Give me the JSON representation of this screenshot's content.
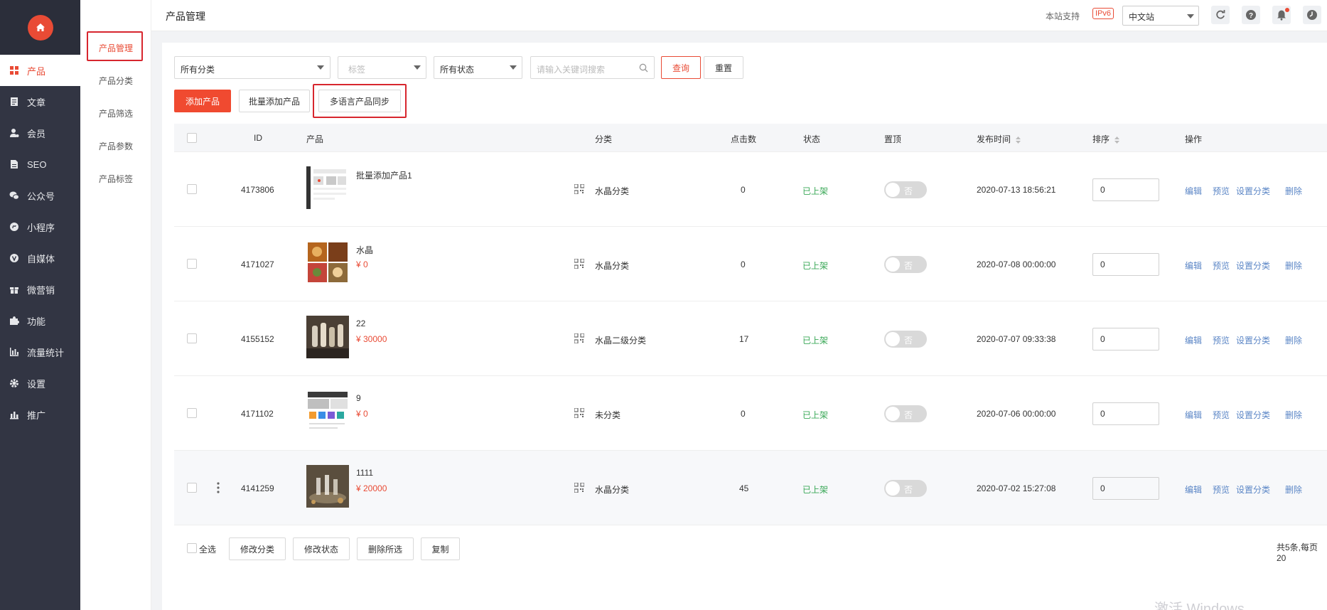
{
  "nav": {
    "items": [
      {
        "label": "产品",
        "icon": "grid-icon"
      },
      {
        "label": "文章",
        "icon": "document-icon"
      },
      {
        "label": "会员",
        "icon": "user-gear-icon"
      },
      {
        "label": "SEO",
        "icon": "file-icon"
      },
      {
        "label": "公众号",
        "icon": "wechat-icon"
      },
      {
        "label": "小程序",
        "icon": "mini-program-icon"
      },
      {
        "label": "自媒体",
        "icon": "v-icon"
      },
      {
        "label": "微营销",
        "icon": "gift-icon"
      },
      {
        "label": "功能",
        "icon": "puzzle-icon"
      },
      {
        "label": "流量统计",
        "icon": "bar-chart-icon"
      },
      {
        "label": "设置",
        "icon": "gear-icon"
      },
      {
        "label": "推广",
        "icon": "stats-icon"
      }
    ]
  },
  "subnav": {
    "items": [
      "产品管理",
      "产品分类",
      "产品筛选",
      "产品参数",
      "产品标签"
    ]
  },
  "header": {
    "title": "产品管理",
    "support_label": "本站支持",
    "ipv6_badge": "IPv6",
    "lang_selected": "中文站"
  },
  "filters": {
    "category": "所有分类",
    "tag_placeholder": "标签",
    "status": "所有状态",
    "search_placeholder": "请输入关键词搜索",
    "query_button": "查询",
    "reset_button": "重置"
  },
  "actions": {
    "add_product": "添加产品",
    "batch_add": "批量添加产品",
    "multi_lang_sync": "多语言产品同步"
  },
  "table": {
    "headers": {
      "id": "ID",
      "product": "产品",
      "category": "分类",
      "clicks": "点击数",
      "status": "状态",
      "pin": "置顶",
      "publish_time": "发布时间",
      "sort": "排序",
      "ops": "操作"
    },
    "toggle_label": "否",
    "op_labels": {
      "edit": "编辑",
      "preview": "预览",
      "set_category": "设置分类",
      "delete": "删除"
    },
    "rows": [
      {
        "id": "4173806",
        "name": "批量添加产品1",
        "price": "",
        "category": "水晶分类",
        "clicks": "0",
        "status": "已上架",
        "time": "2020-07-13 18:56:21",
        "sort": "0"
      },
      {
        "id": "4171027",
        "name": "水晶",
        "price": "¥ 0",
        "category": "水晶分类",
        "clicks": "0",
        "status": "已上架",
        "time": "2020-07-08 00:00:00",
        "sort": "0"
      },
      {
        "id": "4155152",
        "name": "22",
        "price": "¥ 30000",
        "category": "水晶二级分类",
        "clicks": "17",
        "status": "已上架",
        "time": "2020-07-07 09:33:38",
        "sort": "0"
      },
      {
        "id": "4171102",
        "name": "9",
        "price": "¥ 0",
        "category": "未分类",
        "clicks": "0",
        "status": "已上架",
        "time": "2020-07-06 00:00:00",
        "sort": "0"
      },
      {
        "id": "4141259",
        "name": "1111",
        "price": "¥ 20000",
        "category": "水晶分类",
        "clicks": "45",
        "status": "已上架",
        "time": "2020-07-02 15:27:08",
        "sort": "0"
      }
    ]
  },
  "footer": {
    "select_all": "全选",
    "buttons": [
      "修改分类",
      "修改状态",
      "删除所选",
      "复制"
    ],
    "pagination_info": "共5条,每页20"
  },
  "watermark": "激活 Windows",
  "colors": {
    "accent": "#e94b35",
    "nav_bg": "#323543",
    "status_green": "#3aa857",
    "link_blue": "#5b86c6"
  }
}
